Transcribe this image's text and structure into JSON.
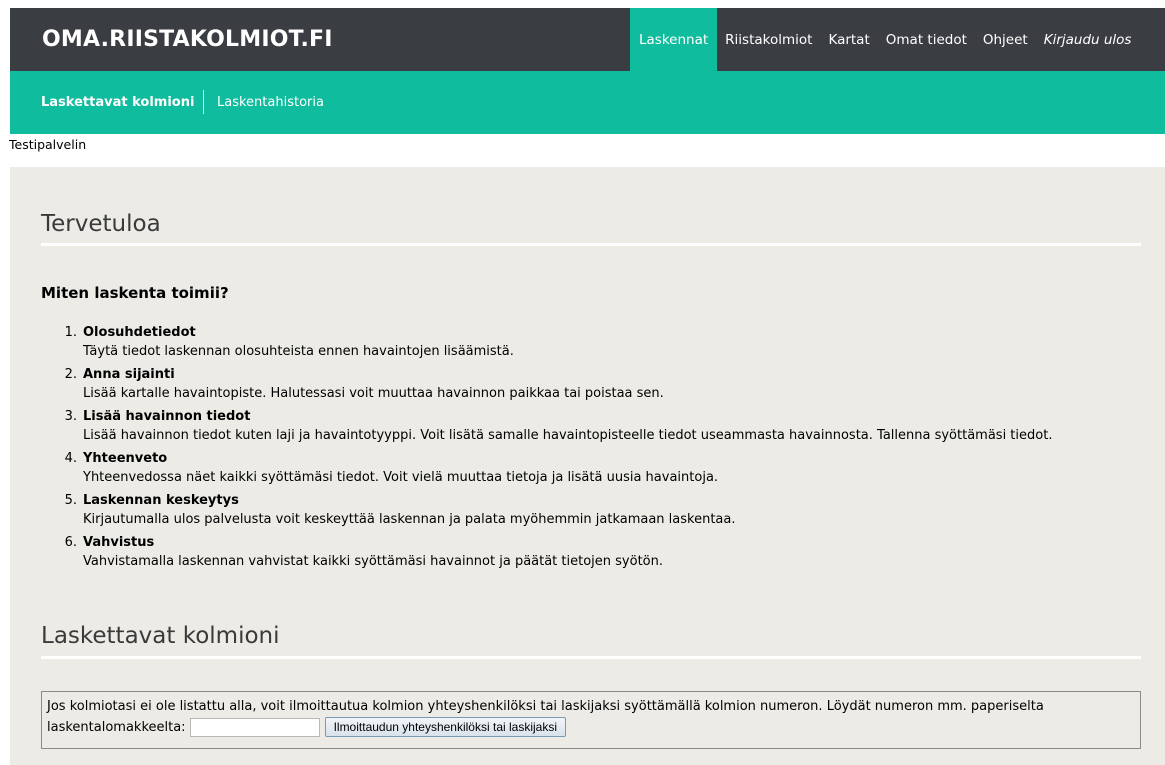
{
  "header": {
    "brand": "OMA.RIISTAKOLMIOT.FI",
    "nav": [
      {
        "label": "Laskennat",
        "active": true
      },
      {
        "label": "Riistakolmiot"
      },
      {
        "label": "Kartat"
      },
      {
        "label": "Omat tiedot"
      },
      {
        "label": "Ohjeet"
      },
      {
        "label": "Kirjaudu ulos",
        "italic": true
      }
    ],
    "colors": {
      "topbar": "#3a3d41",
      "accent": "#0fbd9e"
    }
  },
  "subnav": {
    "items": [
      {
        "label": "Laskettavat kolmioni",
        "active": true
      },
      {
        "label": "Laskentahistoria"
      }
    ]
  },
  "env_label": "Testipalvelin",
  "welcome": {
    "title": "Tervetuloa",
    "subtitle": "Miten laskenta toimii?",
    "steps": [
      {
        "num": "1.",
        "title": "Olosuhdetiedot",
        "desc": "Täytä tiedot laskennan olosuhteista ennen havaintojen lisäämistä."
      },
      {
        "num": "2.",
        "title": "Anna sijainti",
        "desc": "Lisää kartalle havaintopiste. Halutessasi voit muuttaa havainnon paikkaa tai poistaa sen."
      },
      {
        "num": "3.",
        "title": "Lisää havainnon tiedot",
        "desc": "Lisää havainnon tiedot kuten laji ja havaintotyyppi. Voit lisätä samalle havaintopisteelle tiedot useammasta havainnosta. Tallenna syöttämäsi tiedot."
      },
      {
        "num": "4.",
        "title": "Yhteenveto",
        "desc": "Yhteenvedossa näet kaikki syöttämäsi tiedot. Voit vielä muuttaa tietoja ja lisätä uusia havaintoja."
      },
      {
        "num": "5.",
        "title": "Laskennan keskeytys",
        "desc": "Kirjautumalla ulos palvelusta voit keskeyttää laskennan ja palata myöhemmin jatkamaan laskentaa."
      },
      {
        "num": "6.",
        "title": "Vahvistus",
        "desc": "Vahvistamalla laskennan vahvistat kaikki syöttämäsi havainnot ja päätät tietojen syötön."
      }
    ]
  },
  "triangles": {
    "title": "Laskettavat kolmioni",
    "info_line1": "Jos kolmiotasi ei ole listattu alla, voit ilmoittautua kolmion yhteyshenkilöksi tai laskijaksi syöttämällä kolmion numeron. Löydät numeron mm. paperiselta",
    "info_line2": "laskentalomakkeelta:",
    "input_value": "",
    "button_label": "Ilmoittaudun yhteyshenkilöksi tai laskijaksi"
  }
}
